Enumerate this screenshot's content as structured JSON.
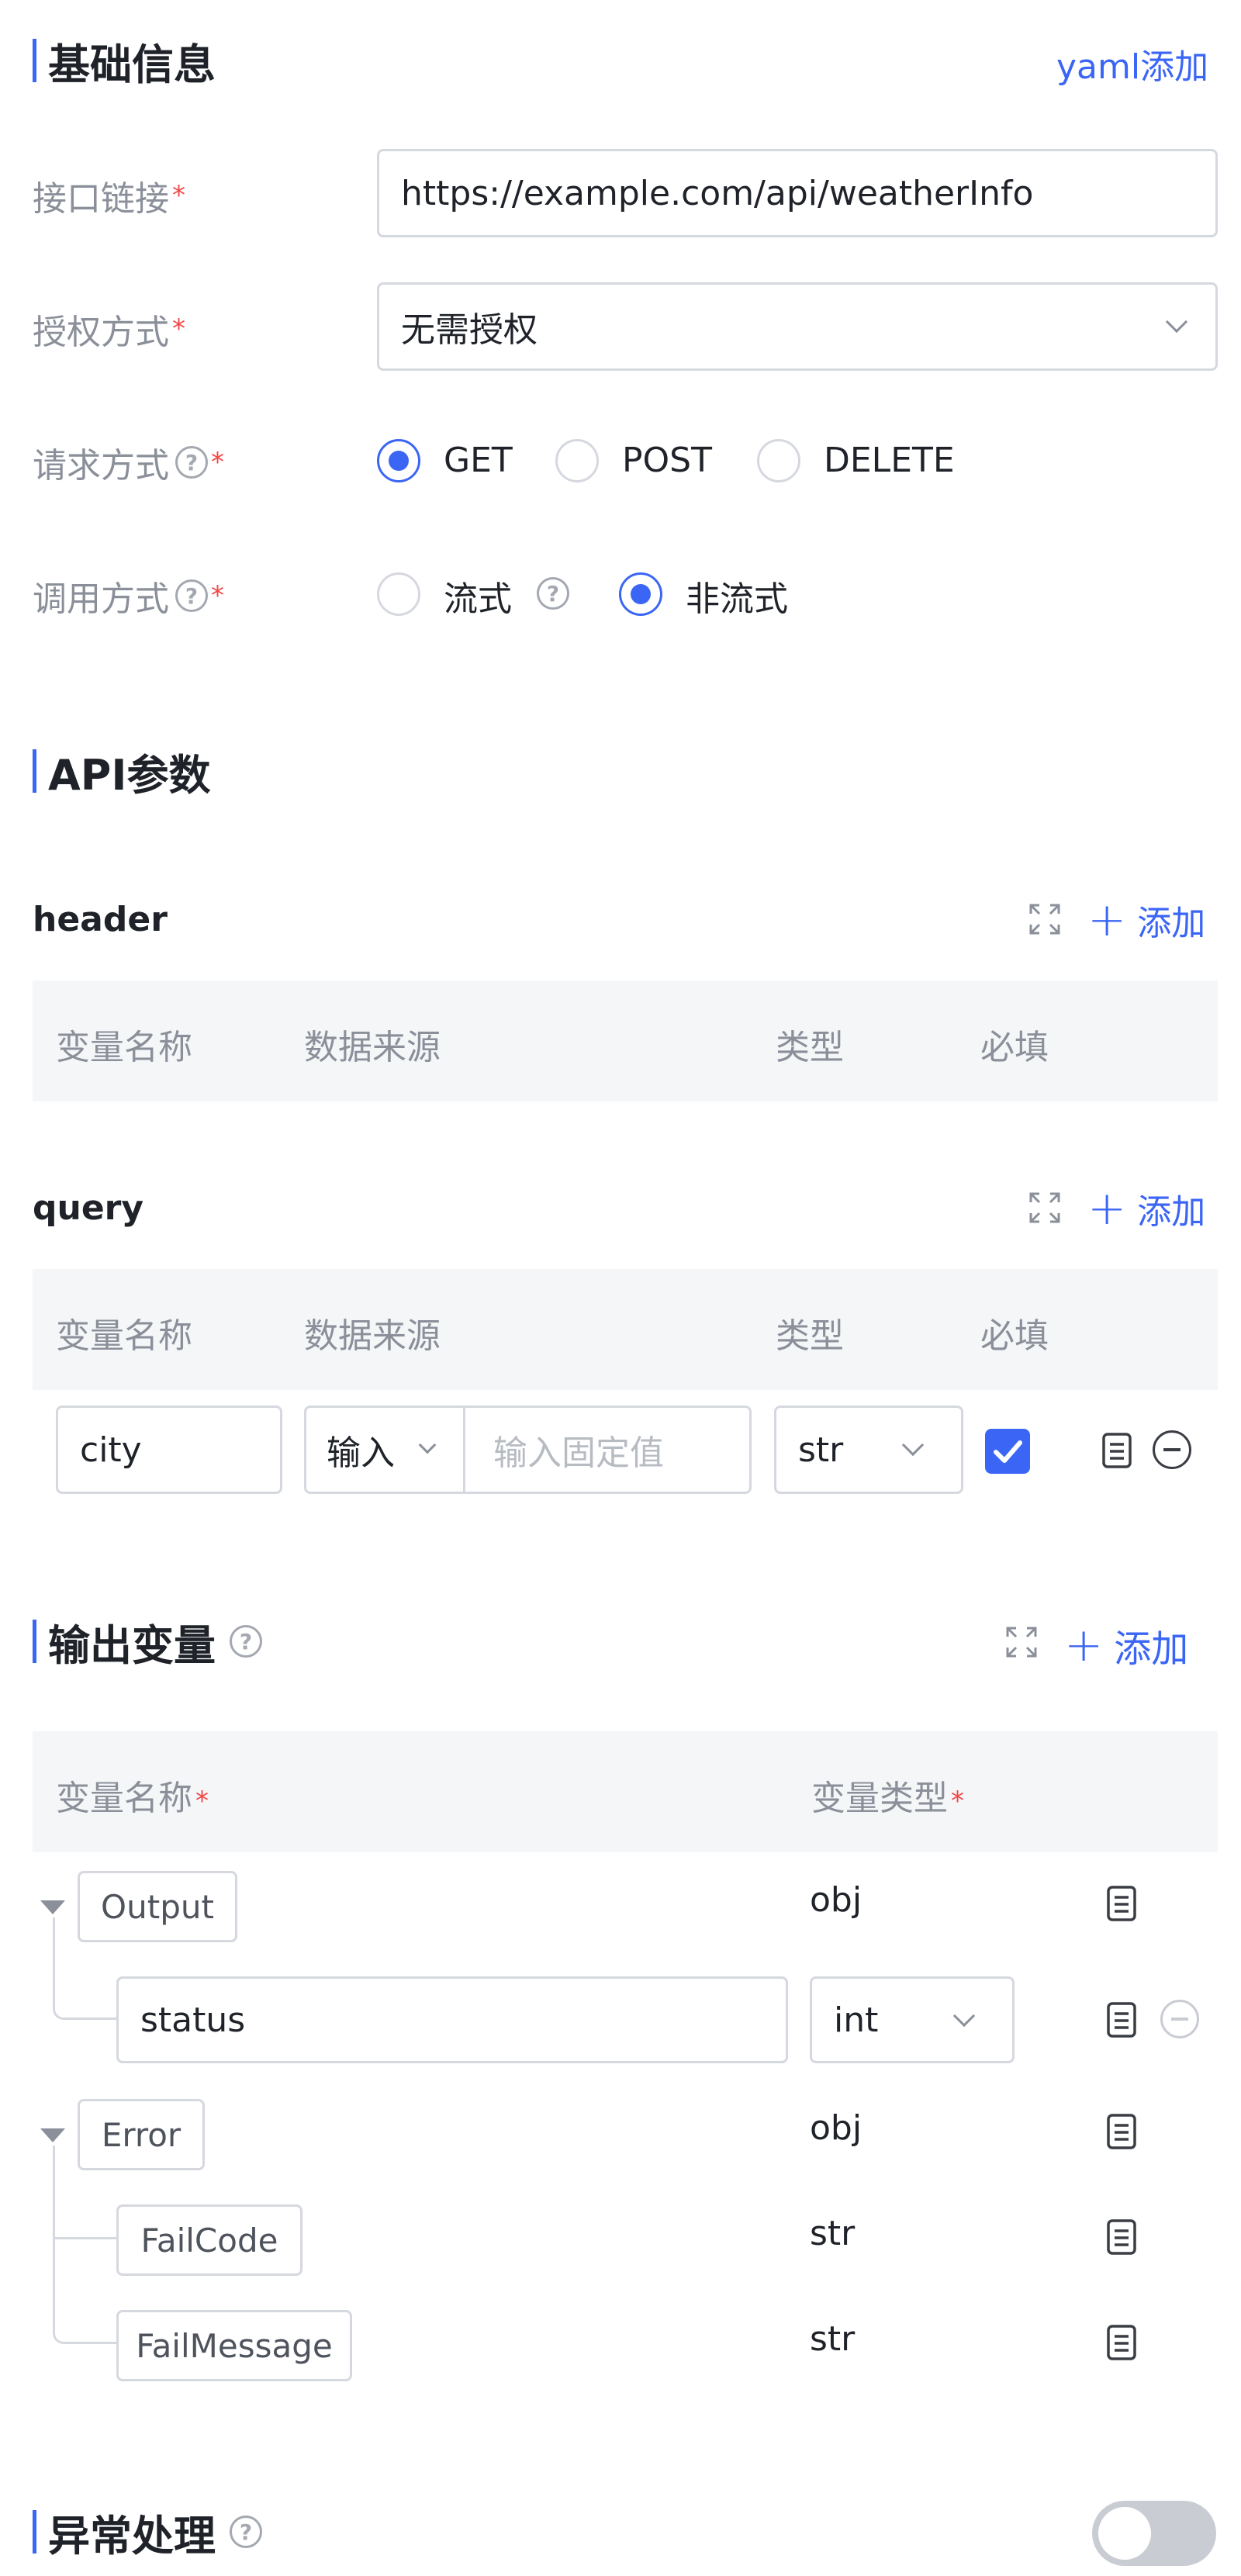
{
  "basic": {
    "title": "基础信息",
    "yaml_add": "yaml添加",
    "url_label": "接口链接",
    "url_value": "https://example.com/api/weatherInfo",
    "auth_label": "授权方式",
    "auth_value": "无需授权",
    "method_label": "请求方式",
    "methods": [
      "GET",
      "POST",
      "DELETE"
    ],
    "method_selected": "GET",
    "call_label": "调用方式",
    "call_options": [
      "流式",
      "非流式"
    ],
    "call_selected": "非流式",
    "required_mark": "*",
    "help_mark": "?"
  },
  "api": {
    "title": "API参数",
    "add_label": "添加",
    "header": {
      "title": "header",
      "columns": [
        "变量名称",
        "数据来源",
        "类型",
        "必填"
      ]
    },
    "query": {
      "title": "query",
      "columns": [
        "变量名称",
        "数据来源",
        "类型",
        "必填"
      ],
      "rows": [
        {
          "name": "city",
          "source": "输入",
          "value_placeholder": "输入固定值",
          "type": "str",
          "required": true
        }
      ]
    }
  },
  "output": {
    "title": "输出变量",
    "add_label": "添加",
    "columns": [
      "变量名称",
      "变量类型"
    ],
    "tree": [
      {
        "name": "Output",
        "type": "obj",
        "children": [
          {
            "name": "status",
            "type": "int"
          }
        ]
      },
      {
        "name": "Error",
        "type": "obj",
        "children": [
          {
            "name": "FailCode",
            "type": "str"
          },
          {
            "name": "FailMessage",
            "type": "str"
          }
        ]
      }
    ]
  },
  "exception": {
    "title": "异常处理",
    "enabled": false
  },
  "colors": {
    "accent": "#3b66f5",
    "required": "#f04848",
    "muted_text": "#8a8f99",
    "header_bg": "#f5f6f8"
  }
}
